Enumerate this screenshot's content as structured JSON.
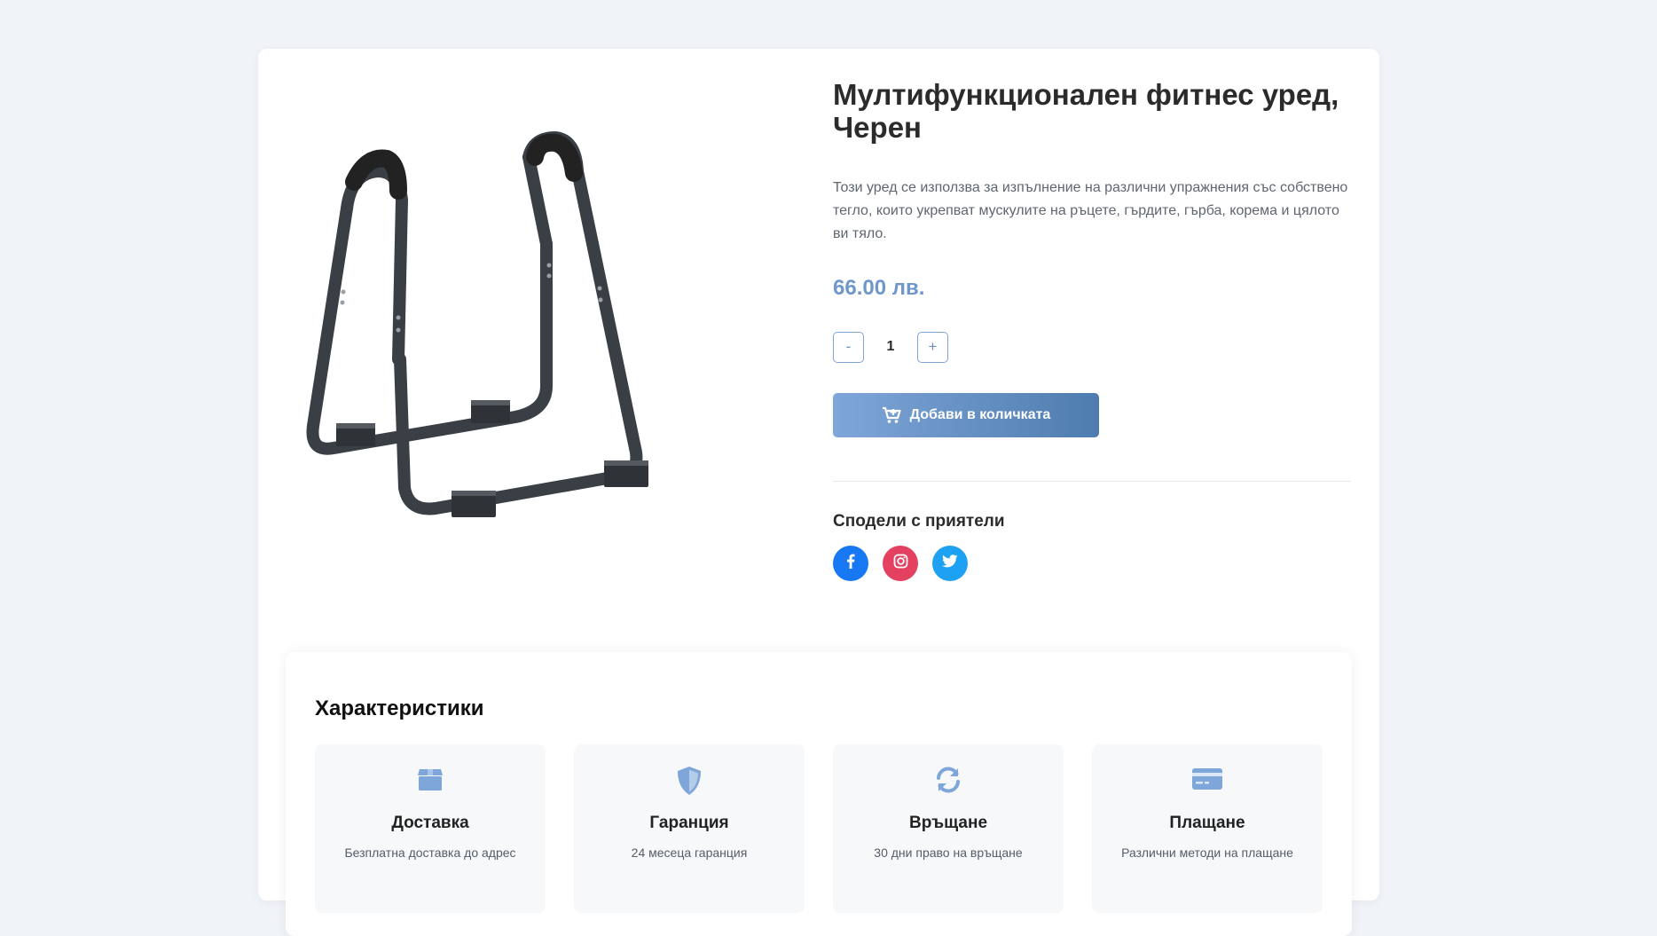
{
  "product": {
    "title": "Мултифункционален фитнес уред, Черен",
    "description": "Този уред се използва за изпълнение на различни упражнения със собствено тегло, които укрепват мускулите на ръцете, гърдите, гърба, корема и цялото ви тяло.",
    "price": "66.00 лв.",
    "image_icon": "dip-station-image"
  },
  "quantity": {
    "decrement_label": "-",
    "value": "1",
    "increment_label": "+"
  },
  "cart": {
    "add_label": "Добави в количката",
    "icon": "cart-plus-icon"
  },
  "share": {
    "title": "Сподели с приятели",
    "networks": [
      {
        "name": "facebook",
        "color": "#1877f2"
      },
      {
        "name": "instagram",
        "color": "#e4405f"
      },
      {
        "name": "twitter",
        "color": "#1da1f2"
      }
    ]
  },
  "features": {
    "title": "Характеристики",
    "items": [
      {
        "icon": "box-icon",
        "title": "Доставка",
        "text": "Безплатна доставка до адрес"
      },
      {
        "icon": "shield-icon",
        "title": "Гаранция",
        "text": "24 месеца гаранция"
      },
      {
        "icon": "sync-icon",
        "title": "Връщане",
        "text": "30 дни право на връщане"
      },
      {
        "icon": "credit-card-icon",
        "title": "Плащане",
        "text": "Различни методи на плащане"
      }
    ]
  },
  "colors": {
    "accent": "#7fa6d8",
    "price": "#6f97cc",
    "background": "#f0f3f7"
  }
}
